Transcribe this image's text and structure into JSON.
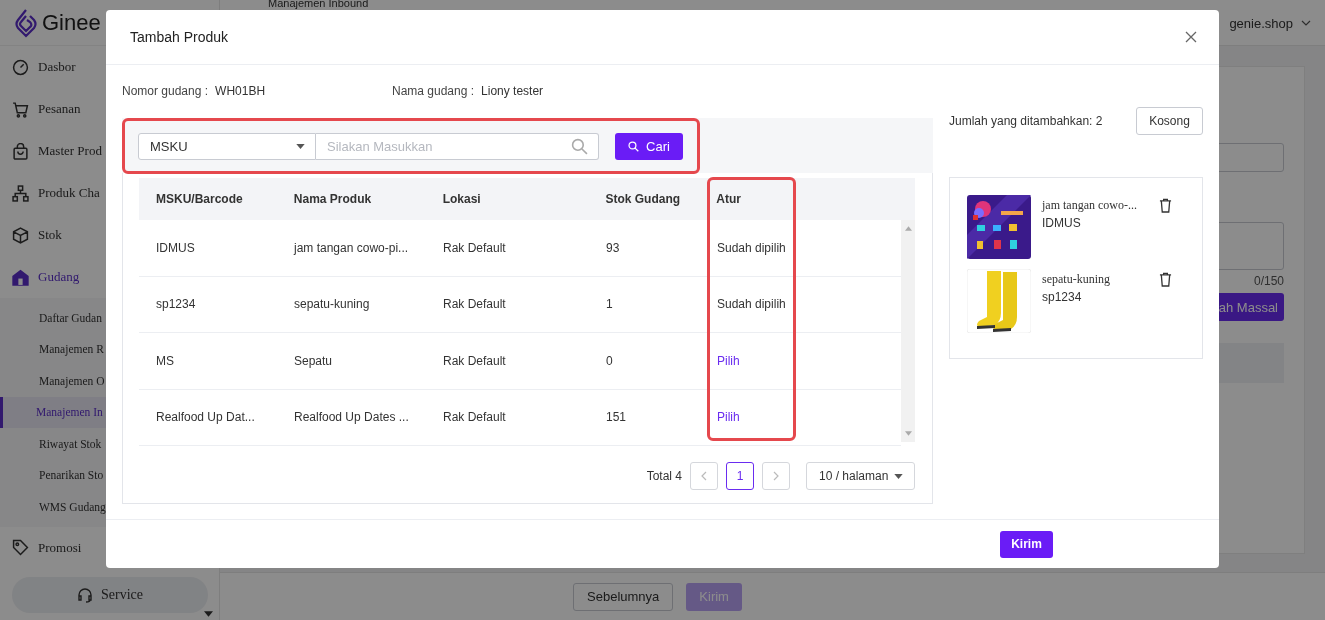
{
  "app": {
    "logo": "Ginee",
    "breadcrumb": "Manajemen Inbound",
    "account": "genie.shop"
  },
  "sidebar": {
    "items": [
      {
        "label": "Dasbor",
        "selected": false
      },
      {
        "label": "Pesanan",
        "selected": false
      },
      {
        "label": "Master Prod",
        "selected": false
      },
      {
        "label": "Produk Cha",
        "selected": false
      },
      {
        "label": "Stok",
        "selected": false
      },
      {
        "label": "Gudang",
        "selected": true,
        "children": [
          {
            "label": "Daftar Gudan",
            "selected": false
          },
          {
            "label": "Manajemen R",
            "selected": false
          },
          {
            "label": "Manajemen O",
            "selected": false
          },
          {
            "label": "Manajemen In",
            "selected": true
          },
          {
            "label": "Riwayat Stok",
            "selected": false
          },
          {
            "label": "Penarikan Sto",
            "selected": false
          },
          {
            "label": "WMS Gudang",
            "selected": false
          }
        ]
      },
      {
        "label": "Promosi",
        "selected": false
      }
    ],
    "service_button": "Service"
  },
  "background_form": {
    "counter": "0/150",
    "bulk_button": "ah Massal"
  },
  "footer_buttons": [
    {
      "label": "Sebelumnya",
      "kind": "default"
    },
    {
      "label": "Kirim",
      "kind": "primary-disabled"
    }
  ],
  "modal": {
    "title": "Tambah Produk",
    "info": [
      {
        "label": "Nomor gudang :",
        "value": "WH01BH"
      },
      {
        "label": "Nama gudang :",
        "value": "Liony tester"
      }
    ],
    "search": {
      "field_type": "MSKU",
      "placeholder": "Silakan Masukkan",
      "button": "Cari"
    },
    "table": {
      "columns": [
        "MSKU/Barcode",
        "Nama Produk",
        "Lokasi",
        "Stok Gudang",
        "Atur"
      ],
      "rows": [
        {
          "cells": [
            "IDMUS",
            "jam tangan cowo-pi...",
            "Rak Default",
            "93"
          ],
          "action": "Sudah dipilih",
          "selected": true
        },
        {
          "cells": [
            "sp1234",
            "sepatu-kuning",
            "Rak Default",
            "1"
          ],
          "action": "Sudah dipilih",
          "selected": true
        },
        {
          "cells": [
            "MS",
            "Sepatu",
            "Rak Default",
            "0"
          ],
          "action": "Pilih",
          "selected": false
        },
        {
          "cells": [
            "Realfood Up Dat...",
            "Realfood Up Dates ...",
            "Rak Default",
            "151"
          ],
          "action": "Pilih",
          "selected": false
        }
      ]
    },
    "pagination": {
      "total": "Total 4",
      "pages": [
        {
          "label": "1",
          "selected": true
        }
      ],
      "page_size": "10 / halaman"
    },
    "added": {
      "count_label": "Jumlah yang ditambahkan: 2",
      "clear_button": "Kosong",
      "items": [
        {
          "name": "jam tangan cowo-...",
          "sku": "IDMUS",
          "kind": "picture"
        },
        {
          "name": "sepatu-kuning",
          "sku": "sp1234",
          "kind": "picture"
        }
      ]
    },
    "submit": "Kirim"
  }
}
